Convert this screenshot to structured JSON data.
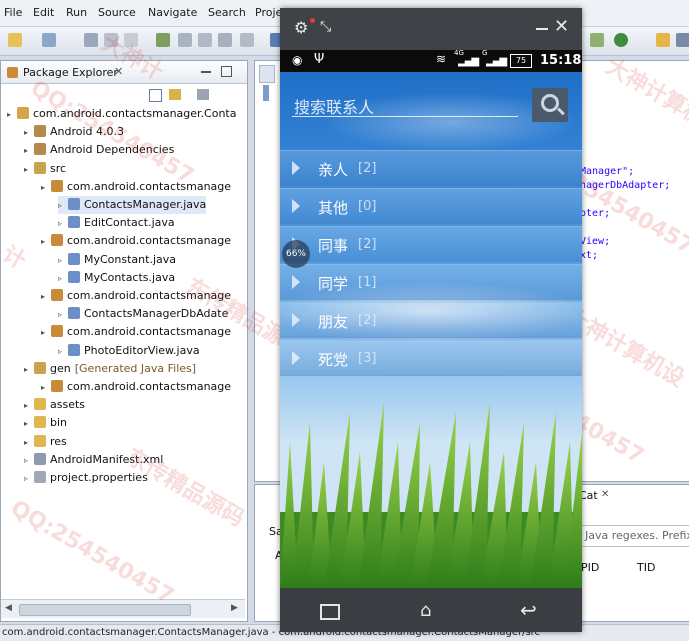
{
  "menu": [
    "File",
    "Edit",
    "Run",
    "Source",
    "Navigate",
    "Search",
    "Proje"
  ],
  "package_explorer": {
    "title": "Package Explorer",
    "tree": [
      {
        "label": "com.android.contactsmanager.Conta",
        "level": 0,
        "icon": "project-icon"
      },
      {
        "label": "Android 4.0.3",
        "level": 1,
        "icon": "library-icon"
      },
      {
        "label": "Android Dependencies",
        "level": 1,
        "icon": "library-icon"
      },
      {
        "label": "src",
        "level": 1,
        "icon": "source-folder-icon"
      },
      {
        "label": "com.android.contactsmanage",
        "level": 2,
        "icon": "package-icon"
      },
      {
        "label": "ContactsManager.java",
        "level": 3,
        "icon": "java-file-icon",
        "selected": true
      },
      {
        "label": "EditContact.java",
        "level": 3,
        "icon": "java-file-icon"
      },
      {
        "label": "com.android.contactsmanage",
        "level": 2,
        "icon": "package-icon"
      },
      {
        "label": "MyConstant.java",
        "level": 3,
        "icon": "java-file-icon"
      },
      {
        "label": "MyContacts.java",
        "level": 3,
        "icon": "java-file-icon"
      },
      {
        "label": "com.android.contactsmanage",
        "level": 2,
        "icon": "package-icon"
      },
      {
        "label": "ContactsManagerDbAdate",
        "level": 3,
        "icon": "java-file-icon"
      },
      {
        "label": "com.android.contactsmanage",
        "level": 2,
        "icon": "package-icon"
      },
      {
        "label": "PhotoEditorView.java",
        "level": 3,
        "icon": "java-file-icon"
      },
      {
        "label": "gen",
        "level": 1,
        "icon": "source-folder-icon",
        "suffix": "[Generated Java Files]"
      },
      {
        "label": "com.android.contactsmanage",
        "level": 2,
        "icon": "package-icon"
      },
      {
        "label": "assets",
        "level": 1,
        "icon": "folder-icon"
      },
      {
        "label": "bin",
        "level": 1,
        "icon": "folder-icon"
      },
      {
        "label": "res",
        "level": 1,
        "icon": "folder-icon"
      },
      {
        "label": "AndroidManifest.xml",
        "level": 1,
        "icon": "xml-file-icon"
      },
      {
        "label": "project.properties",
        "level": 1,
        "icon": "properties-file-icon"
      }
    ]
  },
  "editor_code": [
    "Manager\";",
    "nagerDbAdapter;",
    "pter;",
    "View;",
    "xt;"
  ],
  "logcat": {
    "tab": "Cat",
    "filter_hint": "Java regexes. Prefix",
    "col_pid": "PID",
    "col_tid": "TID",
    "left_labels": [
      "Sa",
      "A"
    ]
  },
  "status_bar_text": "com.android.contactsmanager.ContactsManager.java - com.android.contactsmanager.ContactsManager/src",
  "emulator": {
    "time": "15:18",
    "battery": "75",
    "net_4g": "4G",
    "net_g": "G",
    "zoom_badge": "66%",
    "search_placeholder": "搜索联系人",
    "groups": [
      {
        "name": "亲人",
        "count": "[2]"
      },
      {
        "name": "其他",
        "count": "[0]"
      },
      {
        "name": "同事",
        "count": "[2]"
      },
      {
        "name": "同学",
        "count": "[1]"
      },
      {
        "name": "朋友",
        "count": "[2]"
      },
      {
        "name": "死党",
        "count": "[3]"
      }
    ]
  },
  "watermarks": [
    "大神计算机设",
    "QQ:254540457",
    "计",
    "大神计",
    "QQ:254540457",
    "东传精品源码",
    "QQ:254540457",
    "东传精品源码",
    "QQ:254540457",
    "大神计算机设"
  ]
}
